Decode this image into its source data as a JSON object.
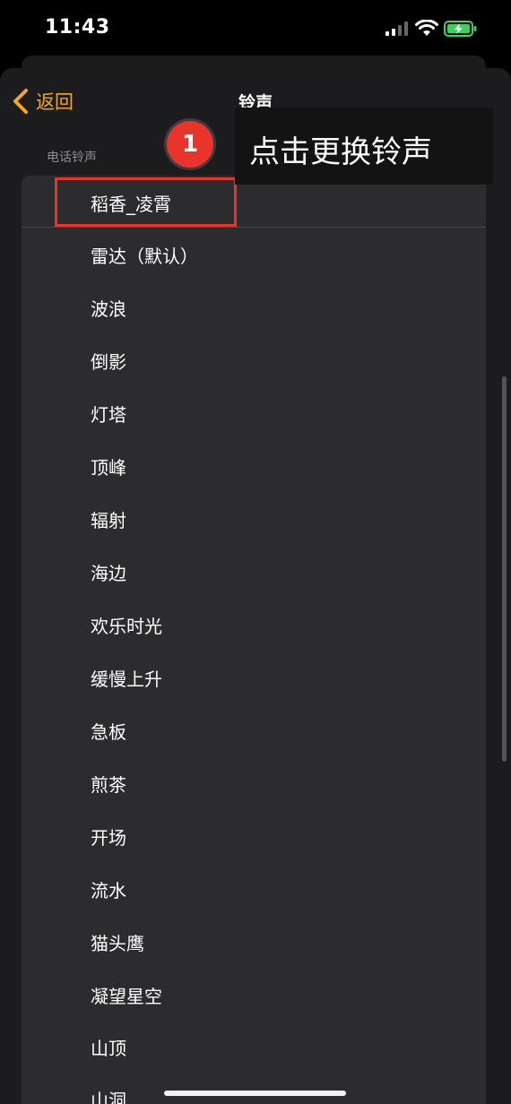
{
  "status_bar": {
    "time": "11:43"
  },
  "nav": {
    "back_label": "返回",
    "title": "铃声"
  },
  "section": {
    "header": "电话铃声"
  },
  "ringtones": [
    "稻香_凌霄",
    "雷达（默认）",
    "波浪",
    "倒影",
    "灯塔",
    "顶峰",
    "辐射",
    "海边",
    "欢乐时光",
    "缓慢上升",
    "急板",
    "煎茶",
    "开场",
    "流水",
    "猫头鹰",
    "凝望星空",
    "山顶",
    "山洞"
  ],
  "annotation": {
    "step": "1",
    "text": "点击更换铃声",
    "highlight_color": "#e8342b"
  },
  "colors": {
    "accent": "#f5a623",
    "background": "#1c1c1e",
    "row": "#2c2c2e"
  }
}
